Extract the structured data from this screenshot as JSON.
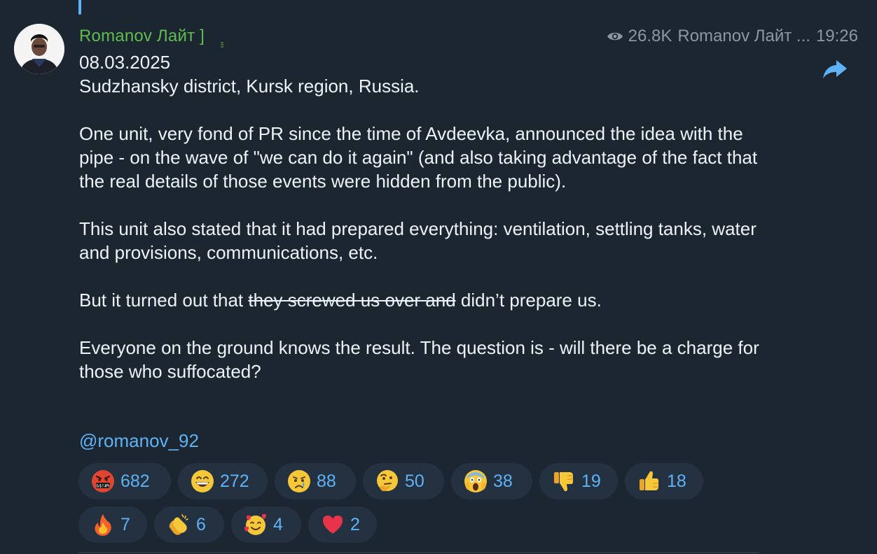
{
  "post": {
    "sender": "Romanov Лайт ]",
    "views": "26.8K",
    "author_sig": "Romanov Лайт ...",
    "time": "19:26",
    "lines": {
      "date": "08.03.2025",
      "location": "Sudzhansky district, Kursk region, Russia.",
      "p1": "One unit, very fond of PR since the time of Avdeevka, announced the idea with the pipe - on the wave of \"we can do it again\" (and also taking advantage of the fact that the real details of those events were hidden from the public).",
      "p2": "This unit also stated that it had prepared everything: ventilation, settling tanks, water and provisions, communications, etc.",
      "p3_before": "But it turned out that ",
      "p3_strike": "they screwed us over and",
      "p3_after": " didn’t prepare us.",
      "p4": "Everyone on the ground knows the result. The question is - will there be a charge for those who suffocated?"
    },
    "mention": "@romanov_92"
  },
  "reactions": [
    {
      "icon": "cursing-face-icon",
      "count": "682"
    },
    {
      "icon": "grinning-face-icon",
      "count": "272"
    },
    {
      "icon": "crying-face-icon",
      "count": "88"
    },
    {
      "icon": "thinking-face-icon",
      "count": "50"
    },
    {
      "icon": "screaming-face-icon",
      "count": "38"
    },
    {
      "icon": "thumbs-down-icon",
      "count": "19"
    },
    {
      "icon": "thumbs-up-icon",
      "count": "18"
    },
    {
      "icon": "fire-icon",
      "count": "7"
    },
    {
      "icon": "clapping-hands-icon",
      "count": "6"
    },
    {
      "icon": "smiling-face-with-hearts-icon",
      "count": "4"
    },
    {
      "icon": "red-heart-icon",
      "count": "2"
    }
  ],
  "colors": {
    "background": "#1c2631",
    "sender_name": "#5ebd4f",
    "link_accent": "#5fb2f5",
    "meta_text": "#8b97a4",
    "reaction_pill": "#243140"
  }
}
